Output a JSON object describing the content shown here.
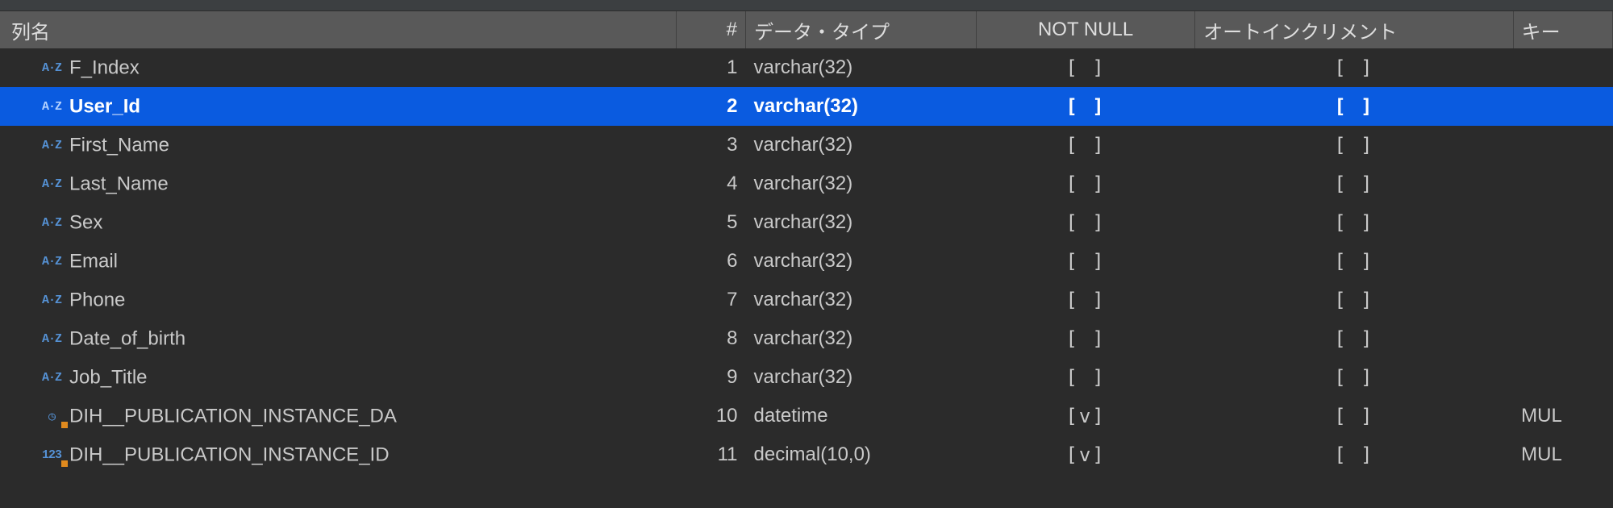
{
  "headers": {
    "name": "列名",
    "num": "#",
    "type": "データ・タイプ",
    "notnull": "NOT NULL",
    "autoinc": "オートインクリメント",
    "key": "キー"
  },
  "check_false": "[ ]",
  "check_true": "[v]",
  "icons": {
    "az": "A·Z",
    "datetime": "◷",
    "decimal": "123"
  },
  "rows": [
    {
      "icon": "az",
      "name": "F_Index",
      "num": "1",
      "type": "varchar(32)",
      "nn": false,
      "ai": false,
      "key": "",
      "sel": false,
      "ov": false
    },
    {
      "icon": "az",
      "name": "User_Id",
      "num": "2",
      "type": "varchar(32)",
      "nn": false,
      "ai": false,
      "key": "",
      "sel": true,
      "ov": false
    },
    {
      "icon": "az",
      "name": "First_Name",
      "num": "3",
      "type": "varchar(32)",
      "nn": false,
      "ai": false,
      "key": "",
      "sel": false,
      "ov": false
    },
    {
      "icon": "az",
      "name": "Last_Name",
      "num": "4",
      "type": "varchar(32)",
      "nn": false,
      "ai": false,
      "key": "",
      "sel": false,
      "ov": false
    },
    {
      "icon": "az",
      "name": "Sex",
      "num": "5",
      "type": "varchar(32)",
      "nn": false,
      "ai": false,
      "key": "",
      "sel": false,
      "ov": false
    },
    {
      "icon": "az",
      "name": "Email",
      "num": "6",
      "type": "varchar(32)",
      "nn": false,
      "ai": false,
      "key": "",
      "sel": false,
      "ov": false
    },
    {
      "icon": "az",
      "name": "Phone",
      "num": "7",
      "type": "varchar(32)",
      "nn": false,
      "ai": false,
      "key": "",
      "sel": false,
      "ov": false
    },
    {
      "icon": "az",
      "name": "Date_of_birth",
      "num": "8",
      "type": "varchar(32)",
      "nn": false,
      "ai": false,
      "key": "",
      "sel": false,
      "ov": false
    },
    {
      "icon": "az",
      "name": "Job_Title",
      "num": "9",
      "type": "varchar(32)",
      "nn": false,
      "ai": false,
      "key": "",
      "sel": false,
      "ov": false
    },
    {
      "icon": "datetime",
      "name": "DIH__PUBLICATION_INSTANCE_DA",
      "num": "10",
      "type": "datetime",
      "nn": true,
      "ai": false,
      "key": "MUL",
      "sel": false,
      "ov": true
    },
    {
      "icon": "decimal",
      "name": "DIH__PUBLICATION_INSTANCE_ID",
      "num": "11",
      "type": "decimal(10,0)",
      "nn": true,
      "ai": false,
      "key": "MUL",
      "sel": false,
      "ov": true
    }
  ]
}
